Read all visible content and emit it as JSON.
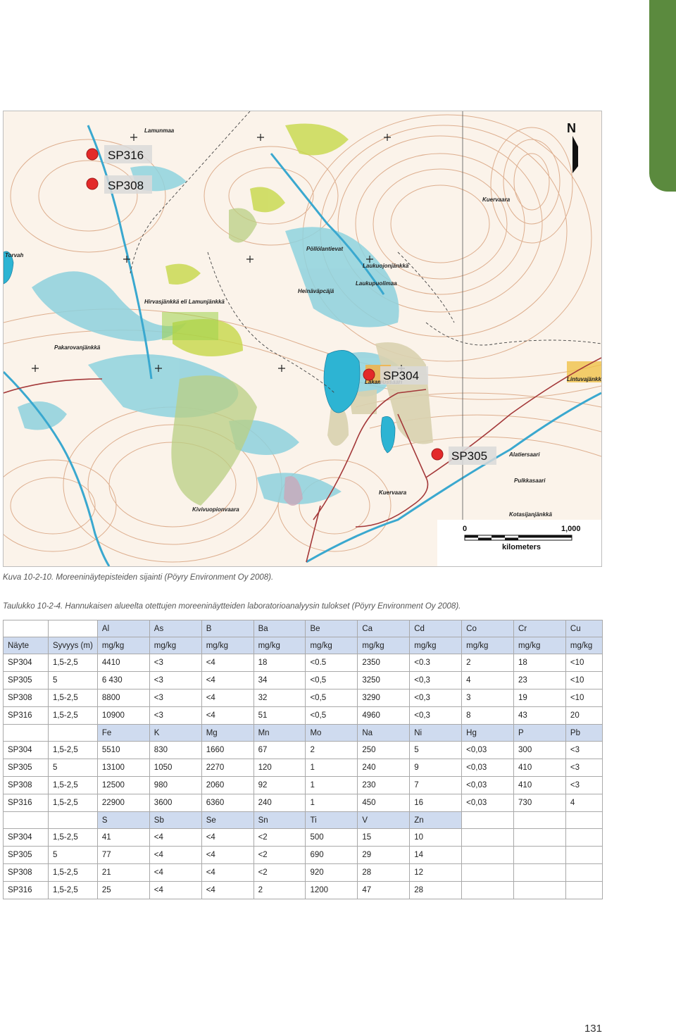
{
  "map": {
    "samples": [
      "SP316",
      "SP308",
      "SP304",
      "SP305"
    ],
    "north_label": "N",
    "scale": {
      "zero": "0",
      "max": "1,000",
      "unit": "kilometers"
    },
    "place_names": [
      "Lamunmaa",
      "Kuervaara",
      "Pöllölantievat",
      "Laukuojonjänkkä",
      "Laukupuolimaa",
      "Heinäväpcäjä",
      "Hirvasjänkkä eli Lamunjänkkä",
      "Pakarovanjänkkä",
      "Lakamussaari",
      "Alatiersaari",
      "Pulkkasaari",
      "Kuervaara",
      "Kotasijanjänkkä",
      "Kivivuopionvaara",
      "Lintuvajänkkä",
      "Torvah"
    ]
  },
  "figure_caption": "Kuva 10-2-10. Moreeninäytepisteiden sijainti (Pöyry Environment Oy 2008).",
  "table_caption": "Taulukko 10-2-4. Hannukaisen alueelta otettujen moreeninäytteiden laboratorioanalyysin tulokset (Pöyry Environment Oy 2008).",
  "table": {
    "block1": {
      "elements": [
        "Al",
        "As",
        "B",
        "Ba",
        "Be",
        "Ca",
        "Cd",
        "Co",
        "Cr",
        "Cu"
      ],
      "unit_row": [
        "Näyte",
        "Syvyys (m)",
        "mg/kg",
        "mg/kg",
        "mg/kg",
        "mg/kg",
        "mg/kg",
        "mg/kg",
        "mg/kg",
        "mg/kg",
        "mg/kg",
        "mg/kg"
      ],
      "rows": [
        [
          "SP304",
          "1,5-2,5",
          "4410",
          "<3",
          "<4",
          "18",
          "<0.5",
          "2350",
          "<0.3",
          "2",
          "18",
          "<10"
        ],
        [
          "SP305",
          "5",
          "6 430",
          "<3",
          "<4",
          "34",
          "<0,5",
          "3250",
          "<0,3",
          "4",
          "23",
          "<10"
        ],
        [
          "SP308",
          "1,5-2,5",
          "8800",
          "<3",
          "<4",
          "32",
          "<0,5",
          "3290",
          "<0,3",
          "3",
          "19",
          "<10"
        ],
        [
          "SP316",
          "1,5-2,5",
          "10900",
          "<3",
          "<4",
          "51",
          "<0,5",
          "4960",
          "<0,3",
          "8",
          "43",
          "20"
        ]
      ]
    },
    "block2": {
      "elements": [
        "Fe",
        "K",
        "Mg",
        "Mn",
        "Mo",
        "Na",
        "Ni",
        "Hg",
        "P",
        "Pb"
      ],
      "rows": [
        [
          "SP304",
          "1,5-2,5",
          "5510",
          "830",
          "1660",
          "67",
          "2",
          "250",
          "5",
          "<0,03",
          "300",
          "<3"
        ],
        [
          "SP305",
          "5",
          "13100",
          "1050",
          "2270",
          "120",
          "1",
          "240",
          "9",
          "<0,03",
          "410",
          "<3"
        ],
        [
          "SP308",
          "1,5-2,5",
          "12500",
          "980",
          "2060",
          "92",
          "1",
          "230",
          "7",
          "<0,03",
          "410",
          "<3"
        ],
        [
          "SP316",
          "1,5-2,5",
          "22900",
          "3600",
          "6360",
          "240",
          "1",
          "450",
          "16",
          "<0,03",
          "730",
          "4"
        ]
      ]
    },
    "block3": {
      "elements": [
        "S",
        "Sb",
        "Se",
        "Sn",
        "Ti",
        "V",
        "Zn"
      ],
      "rows": [
        [
          "SP304",
          "1,5-2,5",
          "41",
          "<4",
          "<4",
          "<2",
          "500",
          "15",
          "10"
        ],
        [
          "SP305",
          "5",
          "77",
          "<4",
          "<4",
          "<2",
          "690",
          "29",
          "14"
        ],
        [
          "SP308",
          "1,5-2,5",
          "21",
          "<4",
          "<4",
          "<2",
          "920",
          "28",
          "12"
        ],
        [
          "SP316",
          "1,5-2,5",
          "25",
          "<4",
          "<4",
          "2",
          "1200",
          "47",
          "28"
        ]
      ]
    }
  },
  "page_number": "131",
  "colors": {
    "accent_tab": "#5b8a3e",
    "header_fill": "#cfdbef",
    "water": "#3fb9d6",
    "sample_marker": "#e32a2a"
  }
}
